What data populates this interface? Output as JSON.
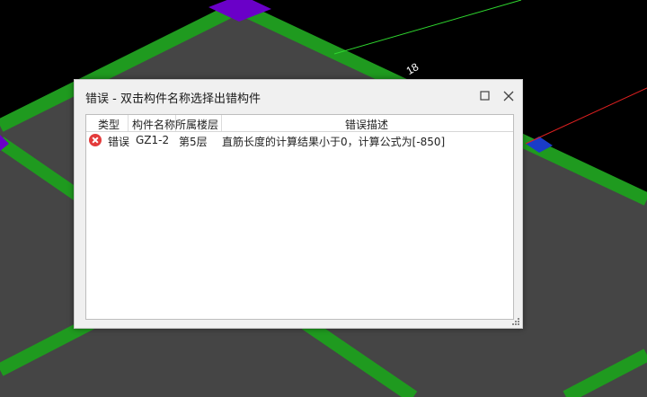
{
  "viewport": {
    "canvas_bg": "#000000",
    "floor_color": "#454545",
    "beam_color": "#1f9a1f",
    "column_color": "#6a00c8",
    "axis_color": "#2fd82f",
    "axis_red_color": "#e02020",
    "node_blue_color": "#1a3cc8",
    "axis_label": "18"
  },
  "dialog": {
    "title": "错误 - 双击构件名称选择出错构件",
    "maximize_icon": "maximize-icon",
    "close_icon": "close-icon",
    "columns": [
      "类型",
      "构件名称",
      "所属楼层",
      "错误描述"
    ],
    "rows": [
      {
        "icon": "error-icon",
        "type": "错误",
        "name": "GZ1-2",
        "floor": "第5层",
        "description": "直筋长度的计算结果小于0，计算公式为[-850]"
      }
    ]
  }
}
